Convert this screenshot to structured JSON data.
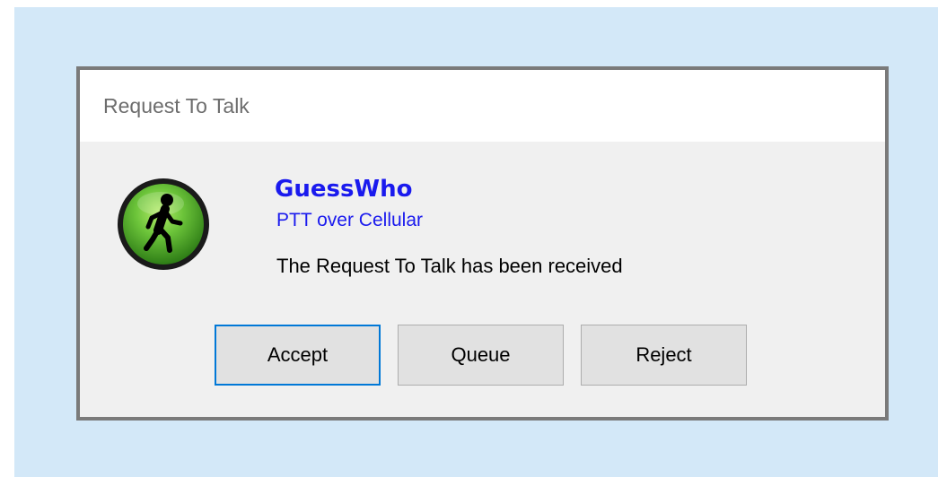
{
  "dialog": {
    "title": "Request To Talk",
    "caller_name": "GuessWho",
    "caller_channel": "PTT over Cellular",
    "message": "The Request To Talk has been received",
    "icon": "walking-person-icon",
    "icon_color": "#5cb82e"
  },
  "buttons": {
    "accept": "Accept",
    "queue": "Queue",
    "reject": "Reject"
  },
  "colors": {
    "backdrop": "#d3e8f8",
    "dialog_border": "#7a7a7a",
    "accent_blue": "#1a1aee",
    "focus_border": "#0078d7"
  }
}
